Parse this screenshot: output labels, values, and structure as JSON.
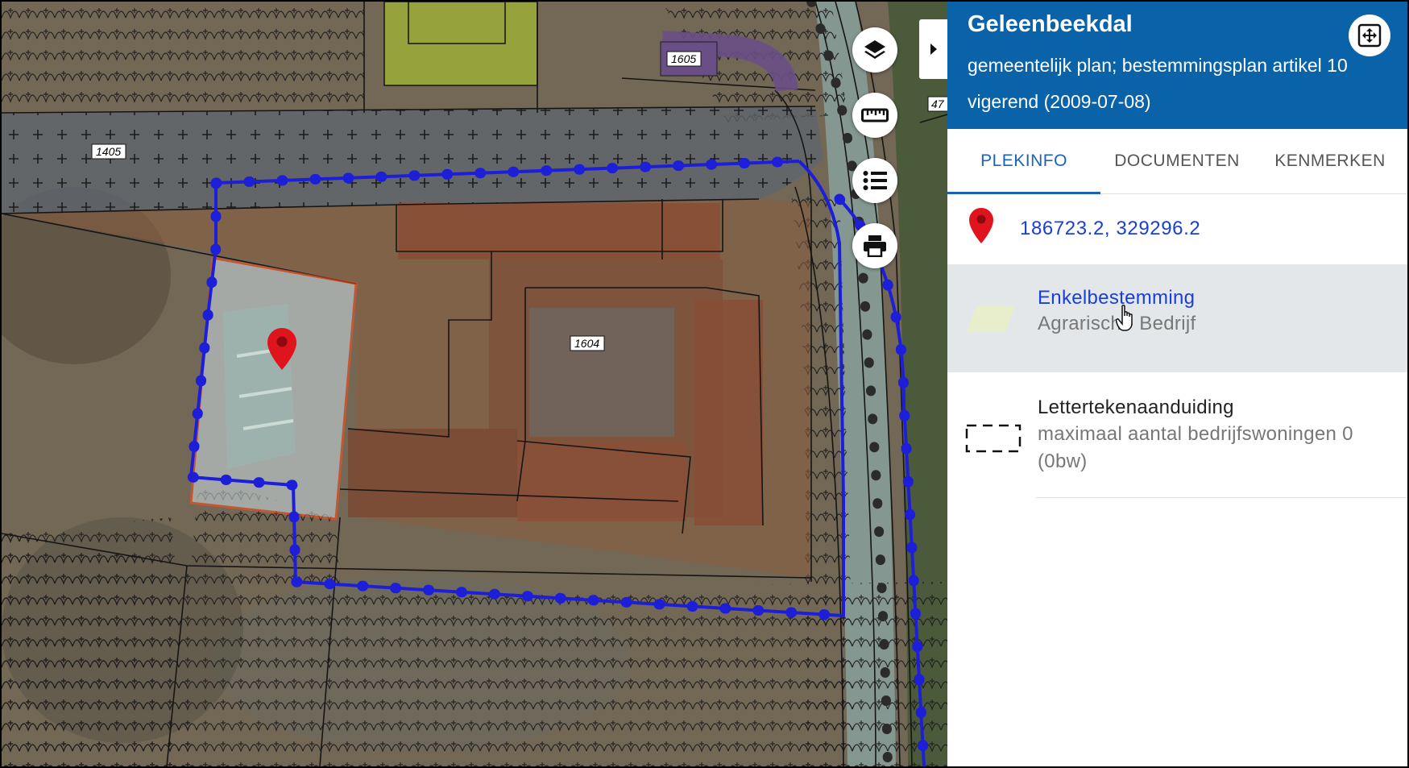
{
  "map": {
    "parcel_labels": [
      "1405",
      "1605",
      "1604"
    ],
    "edge_label": "47",
    "controls": [
      {
        "name": "layers-button",
        "icon": "layers-icon"
      },
      {
        "name": "measure-button",
        "icon": "ruler-icon"
      },
      {
        "name": "legend-button",
        "icon": "list-icon"
      },
      {
        "name": "print-button",
        "icon": "printer-icon"
      }
    ],
    "collapse_icon": "chevron-right-icon",
    "marker_color": "#e0141c",
    "selection_color": "#ff4d1a",
    "boundary_color": "#1d1fd8"
  },
  "panel": {
    "title": "Geleenbeekdal",
    "plan_type": "gemeentelijk plan; bestemmingsplan artikel 10",
    "status": "vigerend (2009-07-08)",
    "header_color": "#0a63a8",
    "fullscreen_icon": "fullscreen-icon",
    "tabs": [
      {
        "label": "PLEKINFO",
        "active": true
      },
      {
        "label": "DOCUMENTEN",
        "active": false
      },
      {
        "label": "KENMERKEN",
        "active": false
      }
    ],
    "coordinates": "186723.2, 329296.2",
    "items": [
      {
        "title": "Enkelbestemming",
        "subtitle": "Agrarisch - Bedrijf",
        "symbol": "parallelogram-swatch-icon",
        "symbol_color": "#e8eecb"
      },
      {
        "title": "Lettertekenaanduiding",
        "subtitle": "maximaal aantal bedrijfswoningen 0 (0bw)",
        "symbol": "dashed-rect-icon"
      }
    ]
  }
}
